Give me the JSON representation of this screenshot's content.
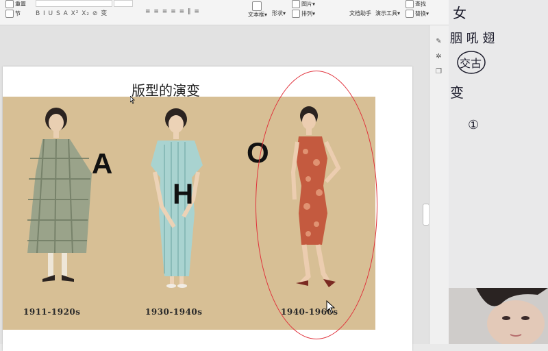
{
  "toolbar": {
    "group1": [
      "重置",
      "节"
    ],
    "text_box": "文本框",
    "shape": "形状",
    "image": "图片",
    "arrange": "排列",
    "assist": "文档助手",
    "present": "演示工具",
    "find": "查找",
    "replace": "替换",
    "format_row": "B  I  U  S  A  X²  X₂  ⊘  变",
    "para_row": "≡ ≡ ≡ ≡ ≡  ‖  ≡"
  },
  "slide": {
    "title": "版型的演变",
    "letters": [
      "A",
      "H",
      "O"
    ],
    "eras": [
      "1911-1920s",
      "1930-1940s",
      "1940-1960s"
    ]
  },
  "side_tools": {
    "icons": [
      "sparkle-icon",
      "star-icon",
      "layers-icon"
    ]
  },
  "notes": {
    "ink_text": [
      "女",
      "胭 吼 翅",
      "交古",
      "变",
      "①"
    ]
  },
  "colors": {
    "annotation": "#e0303a",
    "photo_bg": "#d7bf95"
  }
}
